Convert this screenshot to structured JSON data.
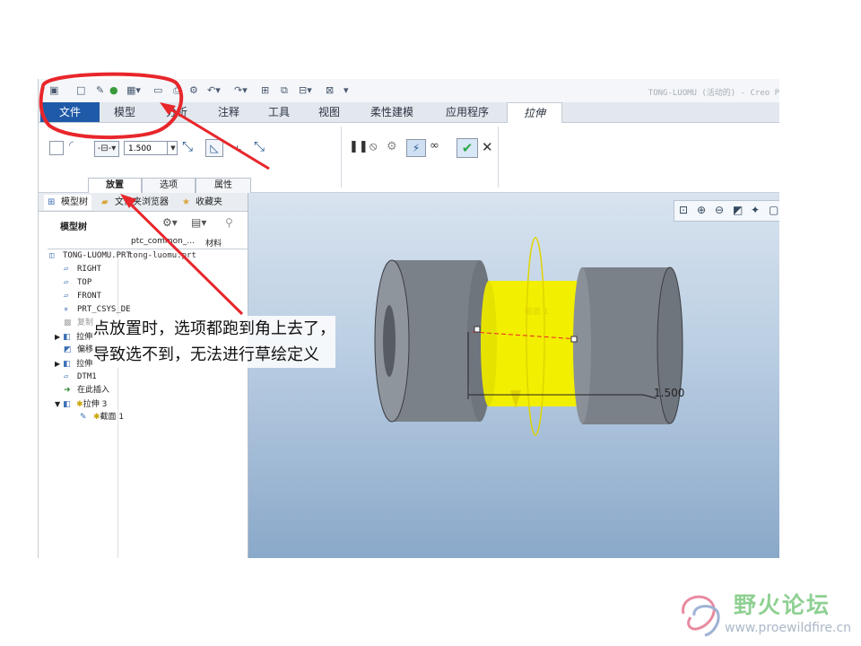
{
  "window_title": "TONG-LUOMU (活动的) - Creo P",
  "quick_access": {
    "icons": [
      "new-icon",
      "open-icon",
      "regenerate-icon",
      "paint-icon",
      "save-icon",
      "folder-icon",
      "print-icon",
      "undo-icon",
      "redo-icon",
      "datum-icon",
      "window-icon",
      "display-icon",
      "close-window-icon"
    ]
  },
  "ribbon_tabs": [
    "文件",
    "模型",
    "分析",
    "注释",
    "工具",
    "视图",
    "柔性建模",
    "应用程序",
    "拉伸"
  ],
  "extrude": {
    "depth_value": "1.500",
    "sub_tabs": [
      "放置",
      "选项",
      "属性"
    ]
  },
  "panel": {
    "tabs": [
      "模型树",
      "文件夹浏览器",
      "收藏夹"
    ],
    "tree_title": "模型树",
    "columns": [
      "ptc_common_...",
      "材料"
    ],
    "rows": [
      {
        "label": "TONG-LUOMU.PRT",
        "col2": "tong-luomu.prt"
      },
      {
        "label": "RIGHT"
      },
      {
        "label": "TOP"
      },
      {
        "label": "FRONT"
      },
      {
        "label": "PRT_CSYS_DE"
      },
      {
        "label": "复制"
      },
      {
        "label": "拉伸"
      },
      {
        "label": "偏移"
      },
      {
        "label": "拉伸"
      },
      {
        "label": "DTM1"
      },
      {
        "label": "在此插入"
      },
      {
        "label": "拉伸 3"
      },
      {
        "label": "截面 1"
      }
    ]
  },
  "viewport": {
    "dimension": "1.500",
    "section_label": "截面 1"
  },
  "annotation": {
    "line1": "点放置时，选项都跑到角上去了，",
    "line2": "导致选不到，无法进行草绘定义"
  },
  "watermark": {
    "cn": "野火论坛",
    "en": "www.proewildfire.cn"
  },
  "colors": {
    "file_tab": "#1f5aa8",
    "highlight_red": "#e8262b",
    "cylinder_gray": "#7b8189",
    "extrude_yellow": "#f2ef00",
    "check_green": "#2fa84f"
  }
}
